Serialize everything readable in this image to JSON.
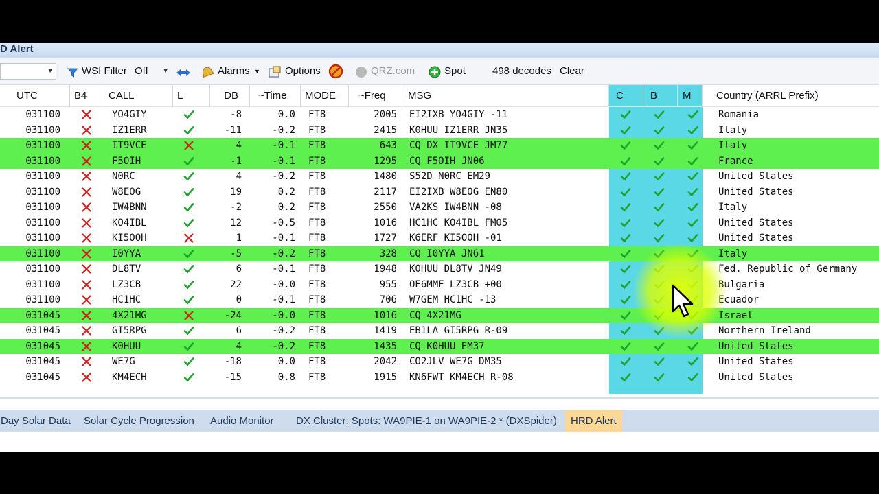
{
  "window": {
    "title": "D Alert"
  },
  "toolbar": {
    "wsi_filter_label": "WSI Filter",
    "wsi_filter_value": "Off",
    "alarms_label": "Alarms",
    "options_label": "Options",
    "qrz_label": "QRZ.com",
    "spot_label": "Spot",
    "decodes": "498 decodes",
    "clear_label": "Clear"
  },
  "columns": [
    "UTC",
    "B4",
    "CALL",
    "L",
    "DB",
    "~Time",
    "MODE",
    "~Freq",
    "MSG",
    "C",
    "B",
    "M",
    "Country (ARRL Prefix)"
  ],
  "rows": [
    {
      "utc": "031100",
      "b4": "x",
      "call": "YO4GIY",
      "l": "check",
      "db": "-8",
      "time": "0.0",
      "mode": "FT8",
      "freq": "2005",
      "msg": "EI2IXB YO4GIY -11",
      "c": "check",
      "b": "check",
      "m": "check",
      "country": "Romania",
      "hl": false
    },
    {
      "utc": "031100",
      "b4": "x",
      "call": "IZ1ERR",
      "l": "check",
      "db": "-11",
      "time": "-0.2",
      "mode": "FT8",
      "freq": "2415",
      "msg": "K0HUU IZ1ERR JN35",
      "c": "check",
      "b": "check",
      "m": "check",
      "country": "Italy",
      "hl": false
    },
    {
      "utc": "031100",
      "b4": "x",
      "call": "IT9VCE",
      "l": "x",
      "db": "4",
      "time": "-0.1",
      "mode": "FT8",
      "freq": "643",
      "msg": "CQ DX IT9VCE JM77",
      "c": "check",
      "b": "check",
      "m": "check",
      "country": "Italy",
      "hl": true
    },
    {
      "utc": "031100",
      "b4": "x",
      "call": "F5OIH",
      "l": "check",
      "db": "-1",
      "time": "-0.1",
      "mode": "FT8",
      "freq": "1295",
      "msg": "CQ F5OIH JN06",
      "c": "check",
      "b": "check",
      "m": "check",
      "country": "France",
      "hl": true
    },
    {
      "utc": "031100",
      "b4": "x",
      "call": "N0RC",
      "l": "check",
      "db": "4",
      "time": "-0.2",
      "mode": "FT8",
      "freq": "1480",
      "msg": "S52D N0RC EM29",
      "c": "check",
      "b": "check",
      "m": "check",
      "country": "United States",
      "hl": false
    },
    {
      "utc": "031100",
      "b4": "x",
      "call": "W8EOG",
      "l": "check",
      "db": "19",
      "time": "0.2",
      "mode": "FT8",
      "freq": "2117",
      "msg": "EI2IXB W8EOG EN80",
      "c": "check",
      "b": "check",
      "m": "check",
      "country": "United States",
      "hl": false
    },
    {
      "utc": "031100",
      "b4": "x",
      "call": "IW4BNN",
      "l": "check",
      "db": "-2",
      "time": "0.2",
      "mode": "FT8",
      "freq": "2550",
      "msg": "VA2KS IW4BNN -08",
      "c": "check",
      "b": "check",
      "m": "check",
      "country": "Italy",
      "hl": false
    },
    {
      "utc": "031100",
      "b4": "x",
      "call": "KO4IBL",
      "l": "check",
      "db": "12",
      "time": "-0.5",
      "mode": "FT8",
      "freq": "1016",
      "msg": "HC1HC KO4IBL FM05",
      "c": "check",
      "b": "check",
      "m": "check",
      "country": "United States",
      "hl": false
    },
    {
      "utc": "031100",
      "b4": "x",
      "call": "KI5OOH",
      "l": "x",
      "db": "1",
      "time": "-0.1",
      "mode": "FT8",
      "freq": "1727",
      "msg": "K6ERF KI5OOH -01",
      "c": "check",
      "b": "check",
      "m": "check",
      "country": "United States",
      "hl": false
    },
    {
      "utc": "031100",
      "b4": "x",
      "call": "I0YYA",
      "l": "check",
      "db": "-5",
      "time": "-0.2",
      "mode": "FT8",
      "freq": "328",
      "msg": "CQ I0YYA JN61",
      "c": "check",
      "b": "check",
      "m": "check",
      "country": "Italy",
      "hl": true
    },
    {
      "utc": "031100",
      "b4": "x",
      "call": "DL8TV",
      "l": "check",
      "db": "6",
      "time": "-0.1",
      "mode": "FT8",
      "freq": "1948",
      "msg": "K0HUU DL8TV JN49",
      "c": "check",
      "b": "check",
      "m": "check",
      "country": "Fed. Republic of Germany",
      "hl": false
    },
    {
      "utc": "031100",
      "b4": "x",
      "call": "LZ3CB",
      "l": "check",
      "db": "22",
      "time": "-0.0",
      "mode": "FT8",
      "freq": "955",
      "msg": "OE6MMF LZ3CB +00",
      "c": "check",
      "b": "check",
      "m": "check",
      "country": "Bulgaria",
      "hl": false
    },
    {
      "utc": "031100",
      "b4": "x",
      "call": "HC1HC",
      "l": "check",
      "db": "0",
      "time": "-0.1",
      "mode": "FT8",
      "freq": "706",
      "msg": "W7GEM HC1HC -13",
      "c": "check",
      "b": "check",
      "m": "check",
      "country": "Ecuador",
      "hl": false
    },
    {
      "utc": "031045",
      "b4": "x",
      "call": "4X21MG",
      "l": "x",
      "db": "-24",
      "time": "-0.0",
      "mode": "FT8",
      "freq": "1016",
      "msg": "CQ 4X21MG",
      "c": "check",
      "b": "check",
      "m": "check",
      "country": "Israel",
      "hl": true
    },
    {
      "utc": "031045",
      "b4": "x",
      "call": "GI5RPG",
      "l": "check",
      "db": "6",
      "time": "-0.2",
      "mode": "FT8",
      "freq": "1419",
      "msg": "EB1LA GI5RPG R-09",
      "c": "check",
      "b": "check",
      "m": "check",
      "country": "Northern Ireland",
      "hl": false
    },
    {
      "utc": "031045",
      "b4": "x",
      "call": "K0HUU",
      "l": "check",
      "db": "4",
      "time": "-0.2",
      "mode": "FT8",
      "freq": "1435",
      "msg": "CQ K0HUU EM37",
      "c": "check",
      "b": "check",
      "m": "check",
      "country": "United States",
      "hl": true
    },
    {
      "utc": "031045",
      "b4": "x",
      "call": "WE7G",
      "l": "check",
      "db": "-18",
      "time": "0.0",
      "mode": "FT8",
      "freq": "2042",
      "msg": "CO2JLV WE7G DM35",
      "c": "check",
      "b": "check",
      "m": "check",
      "country": "United States",
      "hl": false
    },
    {
      "utc": "031045",
      "b4": "x",
      "call": "KM4ECH",
      "l": "check",
      "db": "-15",
      "time": "0.8",
      "mode": "FT8",
      "freq": "1915",
      "msg": "KN6FWT KM4ECH R-08",
      "c": "check",
      "b": "check",
      "m": "check",
      "country": "United States",
      "hl": false
    }
  ],
  "tabs": [
    {
      "label": "Day Solar Data",
      "active": false
    },
    {
      "label": "Solar Cycle Progression",
      "active": false
    },
    {
      "label": "Audio Monitor",
      "active": false
    },
    {
      "label": "DX Cluster: Spots: WA9PIE-1 on WA9PIE-2 * (DXSpider)",
      "active": false
    },
    {
      "label": "HRD Alert",
      "active": true
    }
  ],
  "colors": {
    "highlight_row": "#5ef04e",
    "cyan_column": "#5ad8e6",
    "check": "#1fa32c",
    "cross": "#d41e1e",
    "active_tab": "#fcd896"
  }
}
